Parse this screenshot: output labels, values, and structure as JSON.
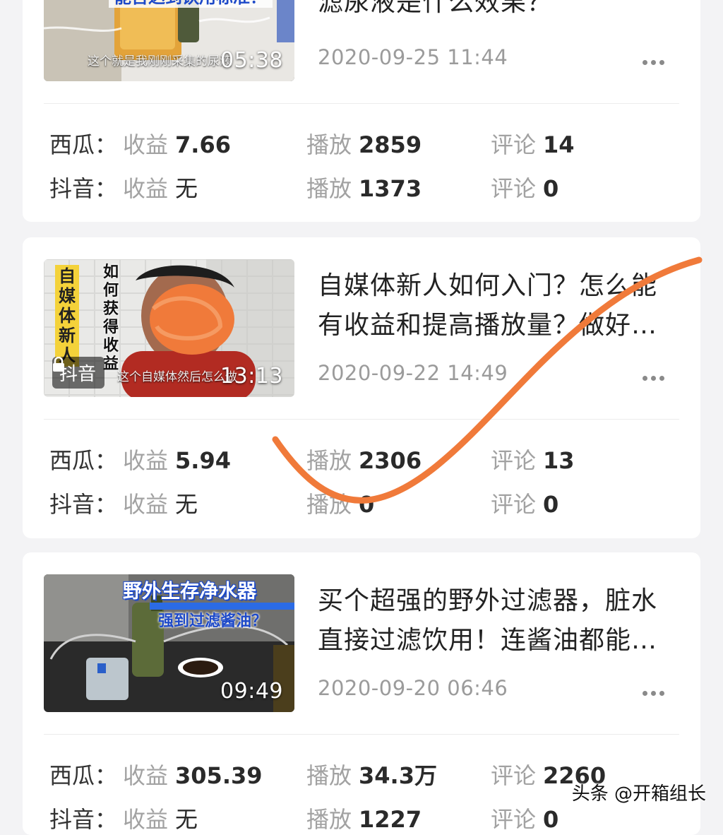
{
  "videos": [
    {
      "title": "滤尿液是什么效果？",
      "date": "2020-09-25 11:44",
      "duration": "05:38",
      "subtitle": "这个就是我刚刚采集的尿液",
      "thumb_caption": "能否达到饮用标准？",
      "stats": [
        {
          "platform": "西瓜：",
          "revenue_label": "收益",
          "revenue": "7.66",
          "plays_label": "播放",
          "plays": "2859",
          "comments_label": "评论",
          "comments": "14"
        },
        {
          "platform": "抖音：",
          "revenue_label": "收益",
          "revenue": "无",
          "plays_label": "播放",
          "plays": "1373",
          "comments_label": "评论",
          "comments": "0"
        }
      ]
    },
    {
      "title_line1": "自媒体新人如何入门？怎么能",
      "title_line2": "有收益和提高播放量？做好…",
      "date": "2020-09-22 14:49",
      "duration": "13:13",
      "subtitle": "这个自媒体然后怎么做",
      "thumb_caption_left": "自媒体新人",
      "thumb_caption_right": "如何获得收益",
      "badge": "抖音",
      "stats": [
        {
          "platform": "西瓜：",
          "revenue_label": "收益",
          "revenue": "5.94",
          "plays_label": "播放",
          "plays": "2306",
          "comments_label": "评论",
          "comments": "13"
        },
        {
          "platform": "抖音：",
          "revenue_label": "收益",
          "revenue": "无",
          "plays_label": "播放",
          "plays": "0",
          "comments_label": "评论",
          "comments": "0"
        }
      ]
    },
    {
      "title_line1": "买个超强的野外过滤器，脏水",
      "title_line2": "直接过滤饮用！连酱油都能…",
      "date": "2020-09-20 06:46",
      "duration": "09:49",
      "thumb_caption_top": "野外生存净水器",
      "thumb_caption_mid": "强到过滤酱油？",
      "stats": [
        {
          "platform": "西瓜：",
          "revenue_label": "收益",
          "revenue": "305.39",
          "plays_label": "播放",
          "plays": "34.3万",
          "comments_label": "评论",
          "comments": "2260"
        },
        {
          "platform": "抖音：",
          "revenue_label": "收益",
          "revenue": "无",
          "plays_label": "播放",
          "plays": "1227",
          "comments_label": "评论",
          "comments": "0"
        }
      ]
    }
  ],
  "watermark": "头条 @开箱组长",
  "colors": {
    "accent_stroke": "#f07a3a",
    "muted": "#9b9b9b",
    "background": "#f3f3f5"
  }
}
